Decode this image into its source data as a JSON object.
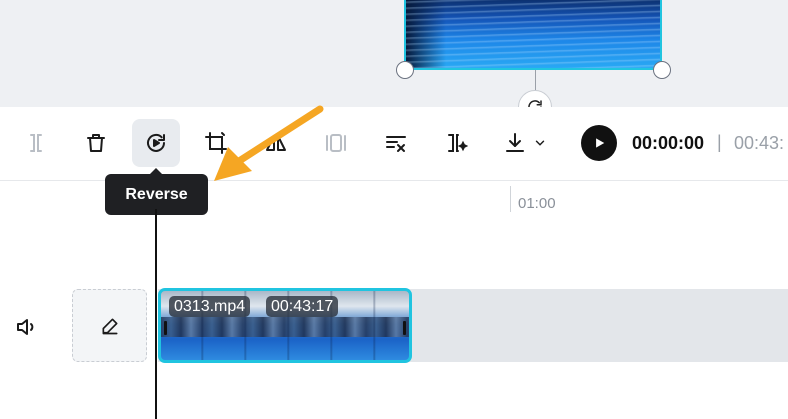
{
  "tooltip": {
    "text": "Reverse"
  },
  "ruler": {
    "mark_label": "01:00"
  },
  "playback": {
    "current_time": "00:00:00",
    "separator": "|",
    "total_time": "00:43:"
  },
  "clip": {
    "filename": "0313.mp4",
    "duration": "00:43:17"
  },
  "toolbar": {
    "tools": [
      "split-icon",
      "delete-icon",
      "reverse-icon",
      "crop-icon",
      "mirror-icon",
      "freeze-icon",
      "remove-background-icon",
      "ai-tools-icon",
      "download-icon"
    ]
  },
  "colors": {
    "accent": "#20c4e0",
    "arrow": "#f5a623",
    "tooltip_bg": "#1f2023"
  }
}
